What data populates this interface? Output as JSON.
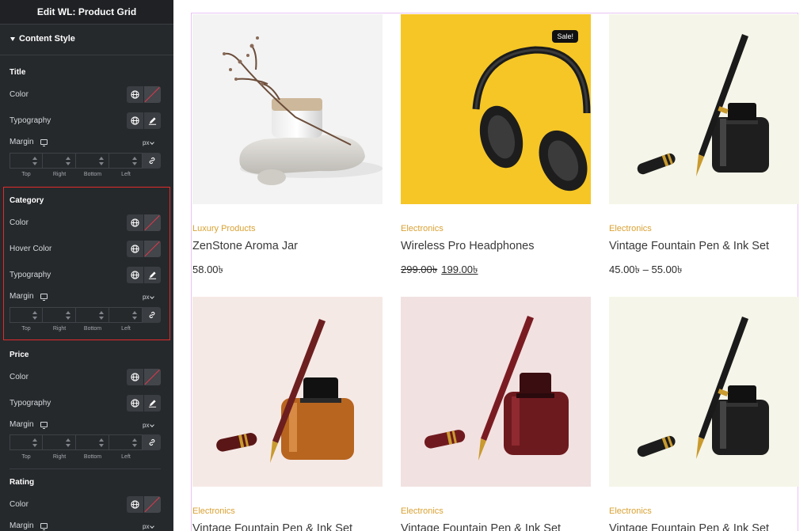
{
  "panel": {
    "header_title": "Edit WL: Product Grid",
    "section_title": "Content Style",
    "groups": {
      "title": {
        "heading": "Title",
        "color_label": "Color",
        "typography_label": "Typography",
        "margin_label": "Margin",
        "unit": "px"
      },
      "category": {
        "heading": "Category",
        "color_label": "Color",
        "hover_color_label": "Hover Color",
        "typography_label": "Typography",
        "margin_label": "Margin",
        "unit": "px"
      },
      "price": {
        "heading": "Price",
        "color_label": "Color",
        "typography_label": "Typography",
        "margin_label": "Margin",
        "unit": "px"
      },
      "rating": {
        "heading": "Rating",
        "color_label": "Color",
        "margin_label": "Margin",
        "unit": "px"
      }
    },
    "dimension_labels": {
      "top": "Top",
      "right": "Right",
      "bottom": "Bottom",
      "left": "Left"
    }
  },
  "products": [
    {
      "category": "Luxury Products",
      "title": "ZenStone Aroma Jar",
      "price": "58.00৳",
      "image": "aroma-jar"
    },
    {
      "category": "Electronics",
      "title": "Wireless Pro Headphones",
      "old_price": "299.00৳",
      "new_price": "199.00৳",
      "badge": "Sale!",
      "image": "headphones"
    },
    {
      "category": "Electronics",
      "title": "Vintage Fountain Pen & Ink Set",
      "price": "45.00৳ – 55.00৳",
      "image": "pen-black"
    },
    {
      "category": "Electronics",
      "title": "Vintage Fountain Pen & Ink Set",
      "image": "pen-amber"
    },
    {
      "category": "Electronics",
      "title": "Vintage Fountain Pen & Ink Set",
      "image": "pen-red"
    },
    {
      "category": "Electronics",
      "title": "Vintage Fountain Pen & Ink Set",
      "image": "pen-black"
    }
  ],
  "colors": {
    "panel_bg": "#26292c",
    "category_text": "#d9a233",
    "highlight_border": "#e02b2b",
    "grid_border": "#e9c3f4",
    "headphones_bg": "#f6c626"
  }
}
